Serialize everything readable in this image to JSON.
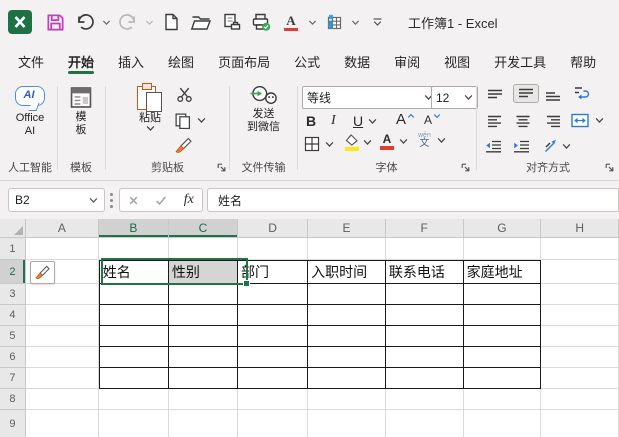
{
  "titlebar": {
    "title": "工作簿1 - Excel"
  },
  "tabs": [
    {
      "label": "文件"
    },
    {
      "label": "开始"
    },
    {
      "label": "插入"
    },
    {
      "label": "绘图"
    },
    {
      "label": "页面布局"
    },
    {
      "label": "公式"
    },
    {
      "label": "数据"
    },
    {
      "label": "审阅"
    },
    {
      "label": "视图"
    },
    {
      "label": "开发工具"
    },
    {
      "label": "帮助"
    }
  ],
  "ribbon": {
    "ai_group": {
      "button": "Office\nAI",
      "icon_text": "AI",
      "label": "人工智能"
    },
    "template_group": {
      "button": "模\n板",
      "label": "模板"
    },
    "clipboard_group": {
      "paste": "粘贴",
      "label": "剪贴板"
    },
    "transfer_group": {
      "button": "发送\n到微信",
      "label": "文件传输"
    },
    "font_group": {
      "font_name": "等线",
      "font_size": "12",
      "bold": "B",
      "italic": "I",
      "underline": "U",
      "grow": "A",
      "shrink": "A",
      "font_color": "A",
      "phonetic_top": "wén",
      "phonetic_bottom": "文",
      "label": "字体"
    },
    "align_group": {
      "label": "对齐方式"
    }
  },
  "formula_bar": {
    "name_box": "B2",
    "fx_label": "fx",
    "value": "姓名"
  },
  "sheet": {
    "col_headers": [
      "A",
      "B",
      "C",
      "D",
      "E",
      "F",
      "G",
      "H"
    ],
    "row_headers": [
      "1",
      "2",
      "3",
      "4",
      "5",
      "6",
      "7",
      "8",
      "9"
    ],
    "selected_columns": [
      "B",
      "C"
    ],
    "selected_row": "2",
    "active_cell": "B2",
    "selected_range": "B2:C2",
    "cells": {
      "B2": "姓名",
      "C2": "性别",
      "D2": "部门",
      "E2": "入职时间",
      "F2": "联系电话",
      "G2": "家庭地址"
    }
  },
  "colors": {
    "accent_green": "#217346",
    "selection_fill": "#D5D5D5",
    "save_magenta": "#BE3FBE",
    "font_red": "#E03C31",
    "highlight_yellow": "#FFE812",
    "accent_blue": "#2B7CD3",
    "wechat_green": "#3BA755",
    "clip_orange": "#C55A11"
  }
}
